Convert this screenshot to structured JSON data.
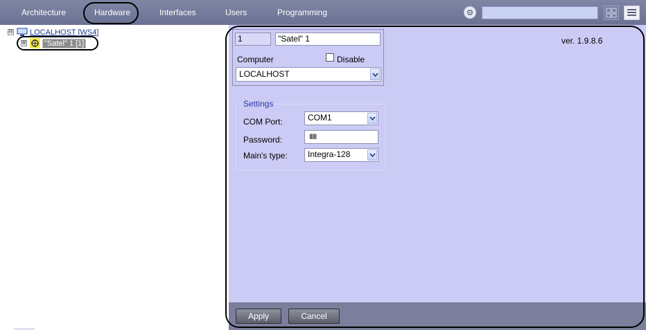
{
  "tabs": [
    {
      "label": "Architecture"
    },
    {
      "label": "Hardware"
    },
    {
      "label": "Interfaces"
    },
    {
      "label": "Users"
    },
    {
      "label": "Programming"
    }
  ],
  "active_tab": "Hardware",
  "search": {
    "value": ""
  },
  "tree": {
    "root": {
      "label": "LOCALHOST [WS4]",
      "expander": "⊟"
    },
    "child": {
      "label": "\"Satel\" 1 [1]",
      "expander": "⊞"
    }
  },
  "panel": {
    "version": "ver. 1.9.8.6",
    "object_id": "1",
    "object_name": "\"Satel\" 1",
    "computer_label": "Computer",
    "disable_label": "Disable",
    "disable_checked": false,
    "computer_value": "LOCALHOST",
    "settings": {
      "legend": "Settings",
      "com_port_label": "COM Port:",
      "com_port_value": "COM1",
      "password_label": "Password:",
      "password_value": "IIIII",
      "mains_type_label": "Main's type:",
      "mains_type_value": "Integra-128"
    },
    "buttons": {
      "apply": "Apply",
      "cancel": "Cancel"
    }
  },
  "colors": {
    "topbar": "#747a9a",
    "panel_bg": "#cccbf5",
    "bottom_bar": "#7b7f9c",
    "settings_legend": "#2d3aa3"
  }
}
